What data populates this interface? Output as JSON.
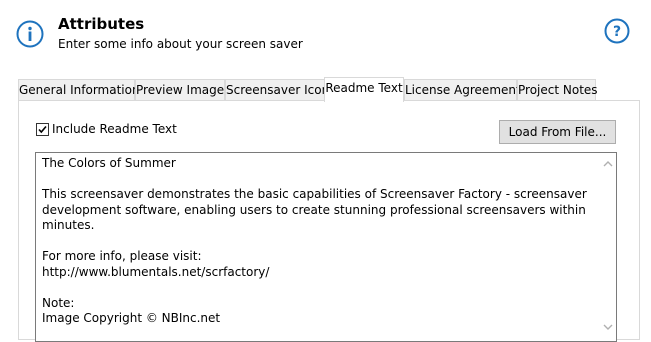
{
  "header": {
    "title": "Attributes",
    "subtitle": "Enter some info about your screen saver"
  },
  "tabs": [
    {
      "label": "General Information"
    },
    {
      "label": "Preview Image"
    },
    {
      "label": "Screensaver Icon"
    },
    {
      "label": "Readme Text",
      "active": true
    },
    {
      "label": "License Agreement"
    },
    {
      "label": "Project Notes"
    }
  ],
  "readme": {
    "include_label": "Include Readme Text",
    "include_checked": true,
    "load_button_label": "Load From File...",
    "text": "The Colors of Summer\n\nThis screensaver demonstrates the basic capabilities of Screensaver Factory - screensaver development software, enabling users to create stunning professional screensavers within minutes.\n\nFor more info, please visit:\nhttp://www.blumentals.net/scrfactory/\n\nNote:\nImage Copyright © NBInc.net"
  },
  "colors": {
    "icon_blue": "#1e73be"
  }
}
